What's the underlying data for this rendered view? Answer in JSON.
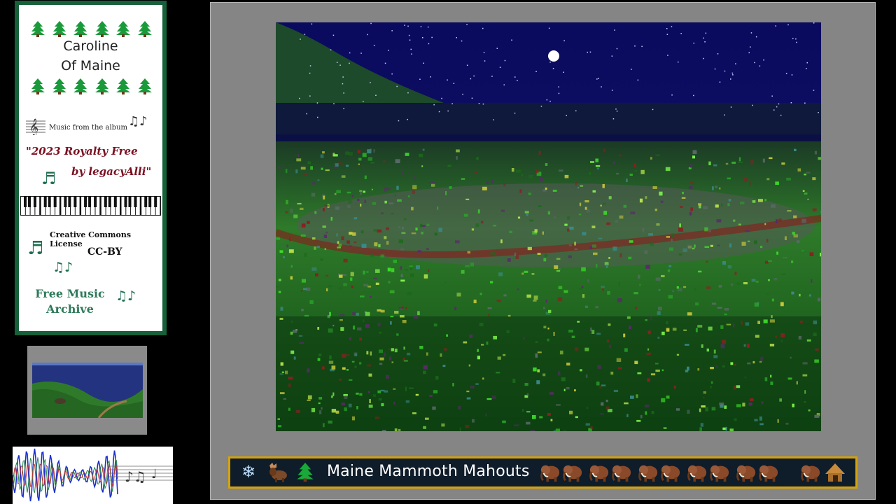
{
  "card": {
    "artist_line1": "Caroline",
    "artist_line2": "Of Maine",
    "music_from": "Music from the album",
    "album_line1": "\"2023 Royalty Free",
    "album_line2": "by legacyAlli\"",
    "license_heading": "Creative Commons License",
    "license": "CC-BY",
    "archive_line1": "Free Music",
    "archive_line2": "Archive",
    "icons": [
      "tree-icon",
      "treble-clef-icon",
      "music-notes-icon",
      "piano-keys-icon"
    ]
  },
  "banner": {
    "title": "Maine Mammoth Mahouts",
    "left_icons": [
      "snowflake-icon",
      "moose-icon",
      "tree-icon"
    ],
    "right_icons": [
      "mammoth-icon",
      "hut-icon"
    ]
  },
  "colors": {
    "card_border": "#16603a",
    "album_text": "#7a1020",
    "archive_text": "#2e7a5a",
    "banner_border": "#d4a30c",
    "banner_bg": "#0f1c2a",
    "viewer_bg": "#858585"
  }
}
